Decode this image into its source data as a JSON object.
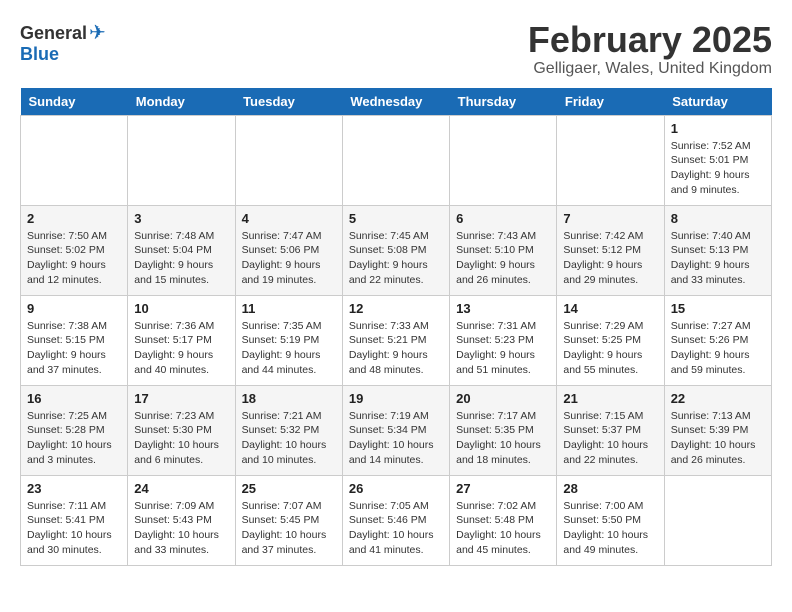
{
  "header": {
    "logo_general": "General",
    "logo_blue": "Blue",
    "title": "February 2025",
    "subtitle": "Gelligaer, Wales, United Kingdom"
  },
  "days_of_week": [
    "Sunday",
    "Monday",
    "Tuesday",
    "Wednesday",
    "Thursday",
    "Friday",
    "Saturday"
  ],
  "weeks": [
    [
      {
        "day": "",
        "info": ""
      },
      {
        "day": "",
        "info": ""
      },
      {
        "day": "",
        "info": ""
      },
      {
        "day": "",
        "info": ""
      },
      {
        "day": "",
        "info": ""
      },
      {
        "day": "",
        "info": ""
      },
      {
        "day": "1",
        "info": "Sunrise: 7:52 AM\nSunset: 5:01 PM\nDaylight: 9 hours and 9 minutes."
      }
    ],
    [
      {
        "day": "2",
        "info": "Sunrise: 7:50 AM\nSunset: 5:02 PM\nDaylight: 9 hours and 12 minutes."
      },
      {
        "day": "3",
        "info": "Sunrise: 7:48 AM\nSunset: 5:04 PM\nDaylight: 9 hours and 15 minutes."
      },
      {
        "day": "4",
        "info": "Sunrise: 7:47 AM\nSunset: 5:06 PM\nDaylight: 9 hours and 19 minutes."
      },
      {
        "day": "5",
        "info": "Sunrise: 7:45 AM\nSunset: 5:08 PM\nDaylight: 9 hours and 22 minutes."
      },
      {
        "day": "6",
        "info": "Sunrise: 7:43 AM\nSunset: 5:10 PM\nDaylight: 9 hours and 26 minutes."
      },
      {
        "day": "7",
        "info": "Sunrise: 7:42 AM\nSunset: 5:12 PM\nDaylight: 9 hours and 29 minutes."
      },
      {
        "day": "8",
        "info": "Sunrise: 7:40 AM\nSunset: 5:13 PM\nDaylight: 9 hours and 33 minutes."
      }
    ],
    [
      {
        "day": "9",
        "info": "Sunrise: 7:38 AM\nSunset: 5:15 PM\nDaylight: 9 hours and 37 minutes."
      },
      {
        "day": "10",
        "info": "Sunrise: 7:36 AM\nSunset: 5:17 PM\nDaylight: 9 hours and 40 minutes."
      },
      {
        "day": "11",
        "info": "Sunrise: 7:35 AM\nSunset: 5:19 PM\nDaylight: 9 hours and 44 minutes."
      },
      {
        "day": "12",
        "info": "Sunrise: 7:33 AM\nSunset: 5:21 PM\nDaylight: 9 hours and 48 minutes."
      },
      {
        "day": "13",
        "info": "Sunrise: 7:31 AM\nSunset: 5:23 PM\nDaylight: 9 hours and 51 minutes."
      },
      {
        "day": "14",
        "info": "Sunrise: 7:29 AM\nSunset: 5:25 PM\nDaylight: 9 hours and 55 minutes."
      },
      {
        "day": "15",
        "info": "Sunrise: 7:27 AM\nSunset: 5:26 PM\nDaylight: 9 hours and 59 minutes."
      }
    ],
    [
      {
        "day": "16",
        "info": "Sunrise: 7:25 AM\nSunset: 5:28 PM\nDaylight: 10 hours and 3 minutes."
      },
      {
        "day": "17",
        "info": "Sunrise: 7:23 AM\nSunset: 5:30 PM\nDaylight: 10 hours and 6 minutes."
      },
      {
        "day": "18",
        "info": "Sunrise: 7:21 AM\nSunset: 5:32 PM\nDaylight: 10 hours and 10 minutes."
      },
      {
        "day": "19",
        "info": "Sunrise: 7:19 AM\nSunset: 5:34 PM\nDaylight: 10 hours and 14 minutes."
      },
      {
        "day": "20",
        "info": "Sunrise: 7:17 AM\nSunset: 5:35 PM\nDaylight: 10 hours and 18 minutes."
      },
      {
        "day": "21",
        "info": "Sunrise: 7:15 AM\nSunset: 5:37 PM\nDaylight: 10 hours and 22 minutes."
      },
      {
        "day": "22",
        "info": "Sunrise: 7:13 AM\nSunset: 5:39 PM\nDaylight: 10 hours and 26 minutes."
      }
    ],
    [
      {
        "day": "23",
        "info": "Sunrise: 7:11 AM\nSunset: 5:41 PM\nDaylight: 10 hours and 30 minutes."
      },
      {
        "day": "24",
        "info": "Sunrise: 7:09 AM\nSunset: 5:43 PM\nDaylight: 10 hours and 33 minutes."
      },
      {
        "day": "25",
        "info": "Sunrise: 7:07 AM\nSunset: 5:45 PM\nDaylight: 10 hours and 37 minutes."
      },
      {
        "day": "26",
        "info": "Sunrise: 7:05 AM\nSunset: 5:46 PM\nDaylight: 10 hours and 41 minutes."
      },
      {
        "day": "27",
        "info": "Sunrise: 7:02 AM\nSunset: 5:48 PM\nDaylight: 10 hours and 45 minutes."
      },
      {
        "day": "28",
        "info": "Sunrise: 7:00 AM\nSunset: 5:50 PM\nDaylight: 10 hours and 49 minutes."
      },
      {
        "day": "",
        "info": ""
      }
    ]
  ]
}
